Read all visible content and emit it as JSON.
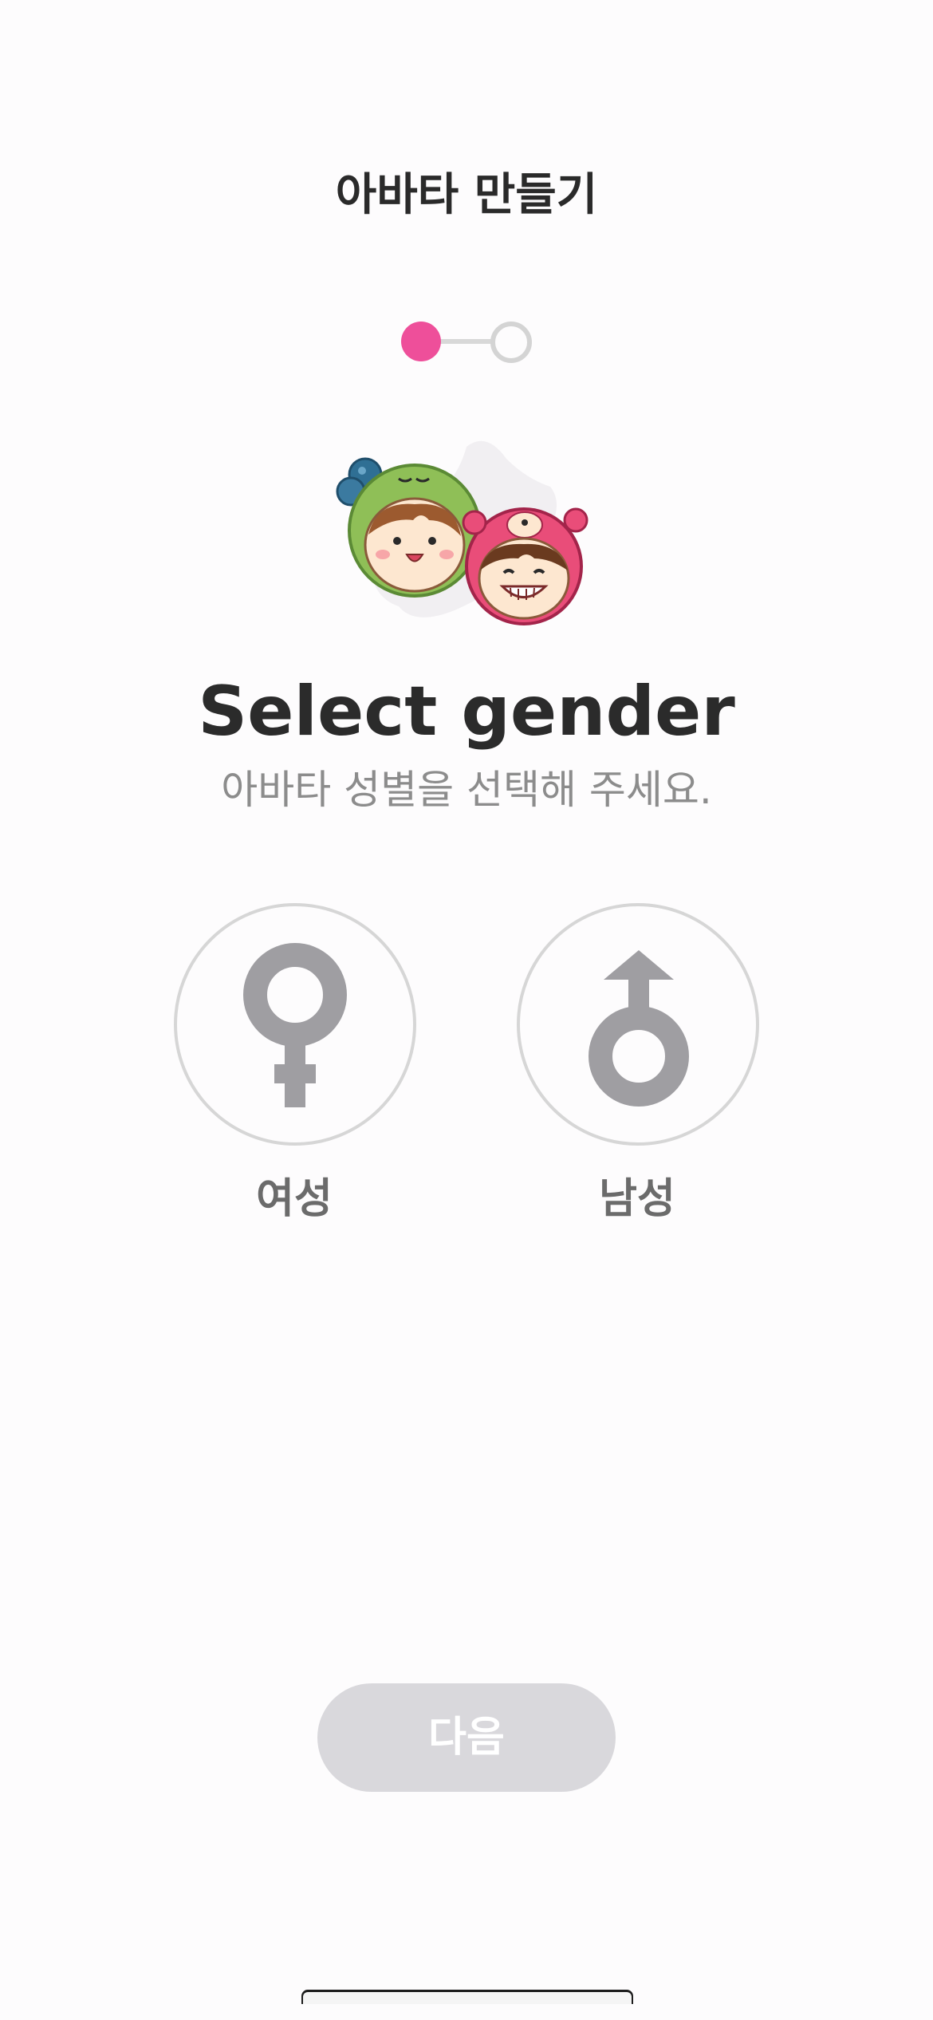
{
  "header": {
    "title": "아바타 만들기"
  },
  "stepper": {
    "current_step": 1,
    "total_steps": 2,
    "active_color": "#ee4f9a",
    "inactive_color": "#d4d4d4"
  },
  "main": {
    "title": "Select gender",
    "subtitle": "아바타 성별을 선택해 주세요."
  },
  "gender_options": [
    {
      "label": "여성",
      "icon": "female-symbol-icon",
      "selected": false
    },
    {
      "label": "남성",
      "icon": "male-symbol-icon",
      "selected": false
    }
  ],
  "footer": {
    "next_label": "다음",
    "next_enabled": false
  },
  "colors": {
    "accent": "#ee4f9a",
    "icon_gray": "#9f9ea2",
    "disabled_button": "#d9d8dc"
  }
}
